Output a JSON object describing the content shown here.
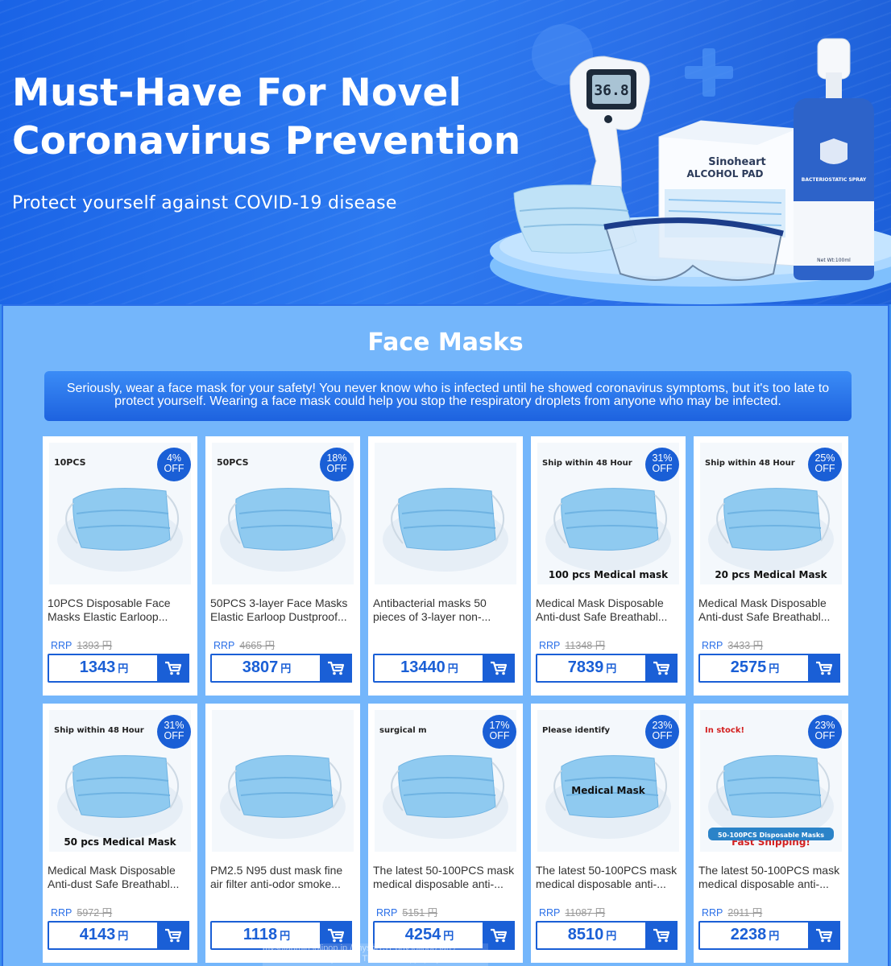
{
  "hero": {
    "title_line1": "Must-Have For Novel",
    "title_line2": "Coronavirus Prevention",
    "subtitle": "Protect yourself against COVID-19 disease",
    "thermometer_reading": "36.8",
    "pad_brand": "Sinoheart",
    "pad_label": "ALCOHOL PAD",
    "spray_label": "BACTERIOSTATIC SPRAY",
    "spray_volume": "Net Wt:100ml"
  },
  "section": {
    "title": "Face Masks",
    "notice": "Seriously, wear a face mask for your safety! You never know who is infected until he showed coronavirus symptoms, but it's too late to protect yourself. Wearing a face mask could help you stop the respiratory droplets from anyone who may be infected."
  },
  "currency_symbol": "円",
  "rrp_label": "RRP",
  "products": [
    {
      "name": "10PCS Disposable Face Masks Elastic Earloop...",
      "discount": "4%",
      "off": "OFF",
      "rrp": "1393 円",
      "price": "1343",
      "image_tag": "10PCS",
      "image_caption": ""
    },
    {
      "name": "50PCS 3-layer Face Masks Elastic Earloop Dustproof...",
      "discount": "18%",
      "off": "OFF",
      "rrp": "4665 円",
      "price": "3807",
      "image_tag": "50PCS",
      "image_caption": ""
    },
    {
      "name": "Antibacterial masks 50 pieces of 3-layer non-...",
      "discount": "",
      "off": "",
      "rrp": "",
      "price": "13440",
      "image_tag": "",
      "image_caption": ""
    },
    {
      "name": "Medical Mask Disposable Anti-dust Safe Breathabl...",
      "discount": "31%",
      "off": "OFF",
      "rrp": "11348 円",
      "price": "7839",
      "image_tag": "Ship within 48 Hour",
      "image_caption": "100 pcs Medical mask"
    },
    {
      "name": "Medical Mask Disposable Anti-dust Safe Breathabl...",
      "discount": "25%",
      "off": "OFF",
      "rrp": "3433 円",
      "price": "2575",
      "image_tag": "Ship within 48 Hour",
      "image_caption": "20 pcs Medical Mask"
    },
    {
      "name": "Medical Mask Disposable Anti-dust Safe Breathabl...",
      "discount": "31%",
      "off": "OFF",
      "rrp": "5972 円",
      "price": "4143",
      "image_tag": "Ship within 48 Hour",
      "image_caption": "50 pcs Medical Mask"
    },
    {
      "name": "PM2.5 N95 dust mask fine air filter anti-odor smoke...",
      "discount": "",
      "off": "",
      "rrp": "",
      "price": "1118",
      "image_tag": "",
      "image_caption": ""
    },
    {
      "name": "The latest 50-100PCS mask medical disposable anti-...",
      "discount": "17%",
      "off": "OFF",
      "rrp": "5151 円",
      "price": "4254",
      "image_tag": "surgical m",
      "image_caption": ""
    },
    {
      "name": "The latest 50-100PCS mask medical disposable anti-...",
      "discount": "23%",
      "off": "OFF",
      "rrp": "11087 円",
      "price": "8510",
      "image_tag": "Please identify",
      "image_caption": "Medical Mask"
    },
    {
      "name": "The latest 50-100PCS mask medical disposable anti-...",
      "discount": "23%",
      "off": "OFF",
      "rrp": "2911 円",
      "price": "2238",
      "image_tag": "In stock!",
      "image_caption": "Fast Shipping!",
      "image_banner": "50-100PCS Disposable Masks"
    }
  ],
  "overlay_text": "mysqladmin.lolipop.jp / mysql131.phy.lolipop.lan / LAA0460347-lotoyosou / TblLotoWin | phpMyAdm",
  "colors": {
    "primary": "#1a5fd6",
    "panel": "#74b6fb",
    "hero": "#2a6fe8"
  },
  "icons": [
    "cart-icon"
  ]
}
